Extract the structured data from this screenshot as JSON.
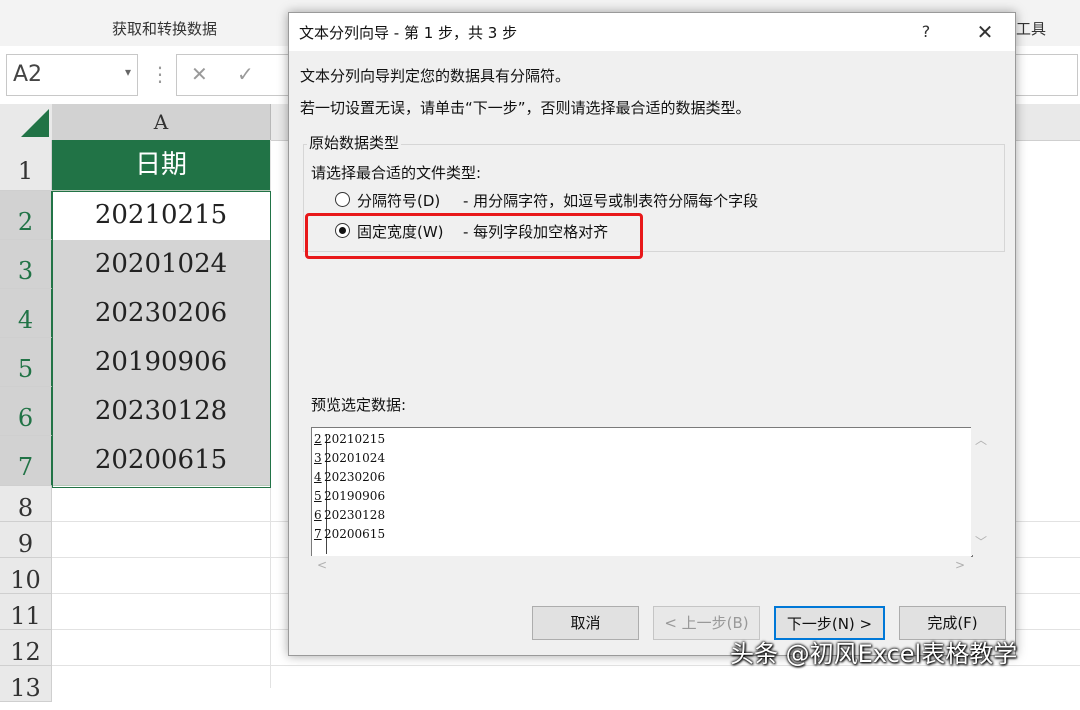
{
  "excel": {
    "ribbon_group_label": "获取和转换数据",
    "ribbon_right_label": "工具",
    "name_box": "A2",
    "formula_symbols": {
      "cancel": "✕",
      "confirm": "✓"
    },
    "column_header": "A",
    "rows": [
      "1",
      "2",
      "3",
      "4",
      "5",
      "6",
      "7",
      "8",
      "9",
      "10",
      "11",
      "12",
      "13"
    ],
    "header_cell": "日期",
    "cells": [
      "20210215",
      "20201024",
      "20230206",
      "20190906",
      "20230128",
      "20200615"
    ]
  },
  "dialog": {
    "title": "文本分列向导 - 第 1 步，共 3 步",
    "help": "?",
    "close": "✕",
    "line1": "文本分列向导判定您的数据具有分隔符。",
    "line2": "若一切设置无误，请单击“下一步”，否则请选择最合适的数据类型。",
    "group_title": "原始数据类型",
    "group_prompt": "请选择最合适的文件类型:",
    "options": [
      {
        "label": "分隔符号(D)",
        "desc": "- 用分隔字符，如逗号或制表符分隔每个字段",
        "selected": false
      },
      {
        "label": "固定宽度(W)",
        "desc": "- 每列字段加空格对齐",
        "selected": true
      }
    ],
    "preview_label": "预览选定数据:",
    "preview_rows": [
      {
        "num": "2",
        "text": "20210215"
      },
      {
        "num": "3",
        "text": "20201024"
      },
      {
        "num": "4",
        "text": "20230206"
      },
      {
        "num": "5",
        "text": "20190906"
      },
      {
        "num": "6",
        "text": "20230128"
      },
      {
        "num": "7",
        "text": "20200615"
      }
    ],
    "buttons": {
      "cancel": "取消",
      "back": "< 上一步(B)",
      "next": "下一步(N) >",
      "finish": "完成(F)"
    }
  },
  "watermark": "头条 @初风Excel表格教学",
  "colors": {
    "excel_green": "#217346",
    "highlight_red": "#e8181a",
    "focus_blue": "#0078d7"
  }
}
